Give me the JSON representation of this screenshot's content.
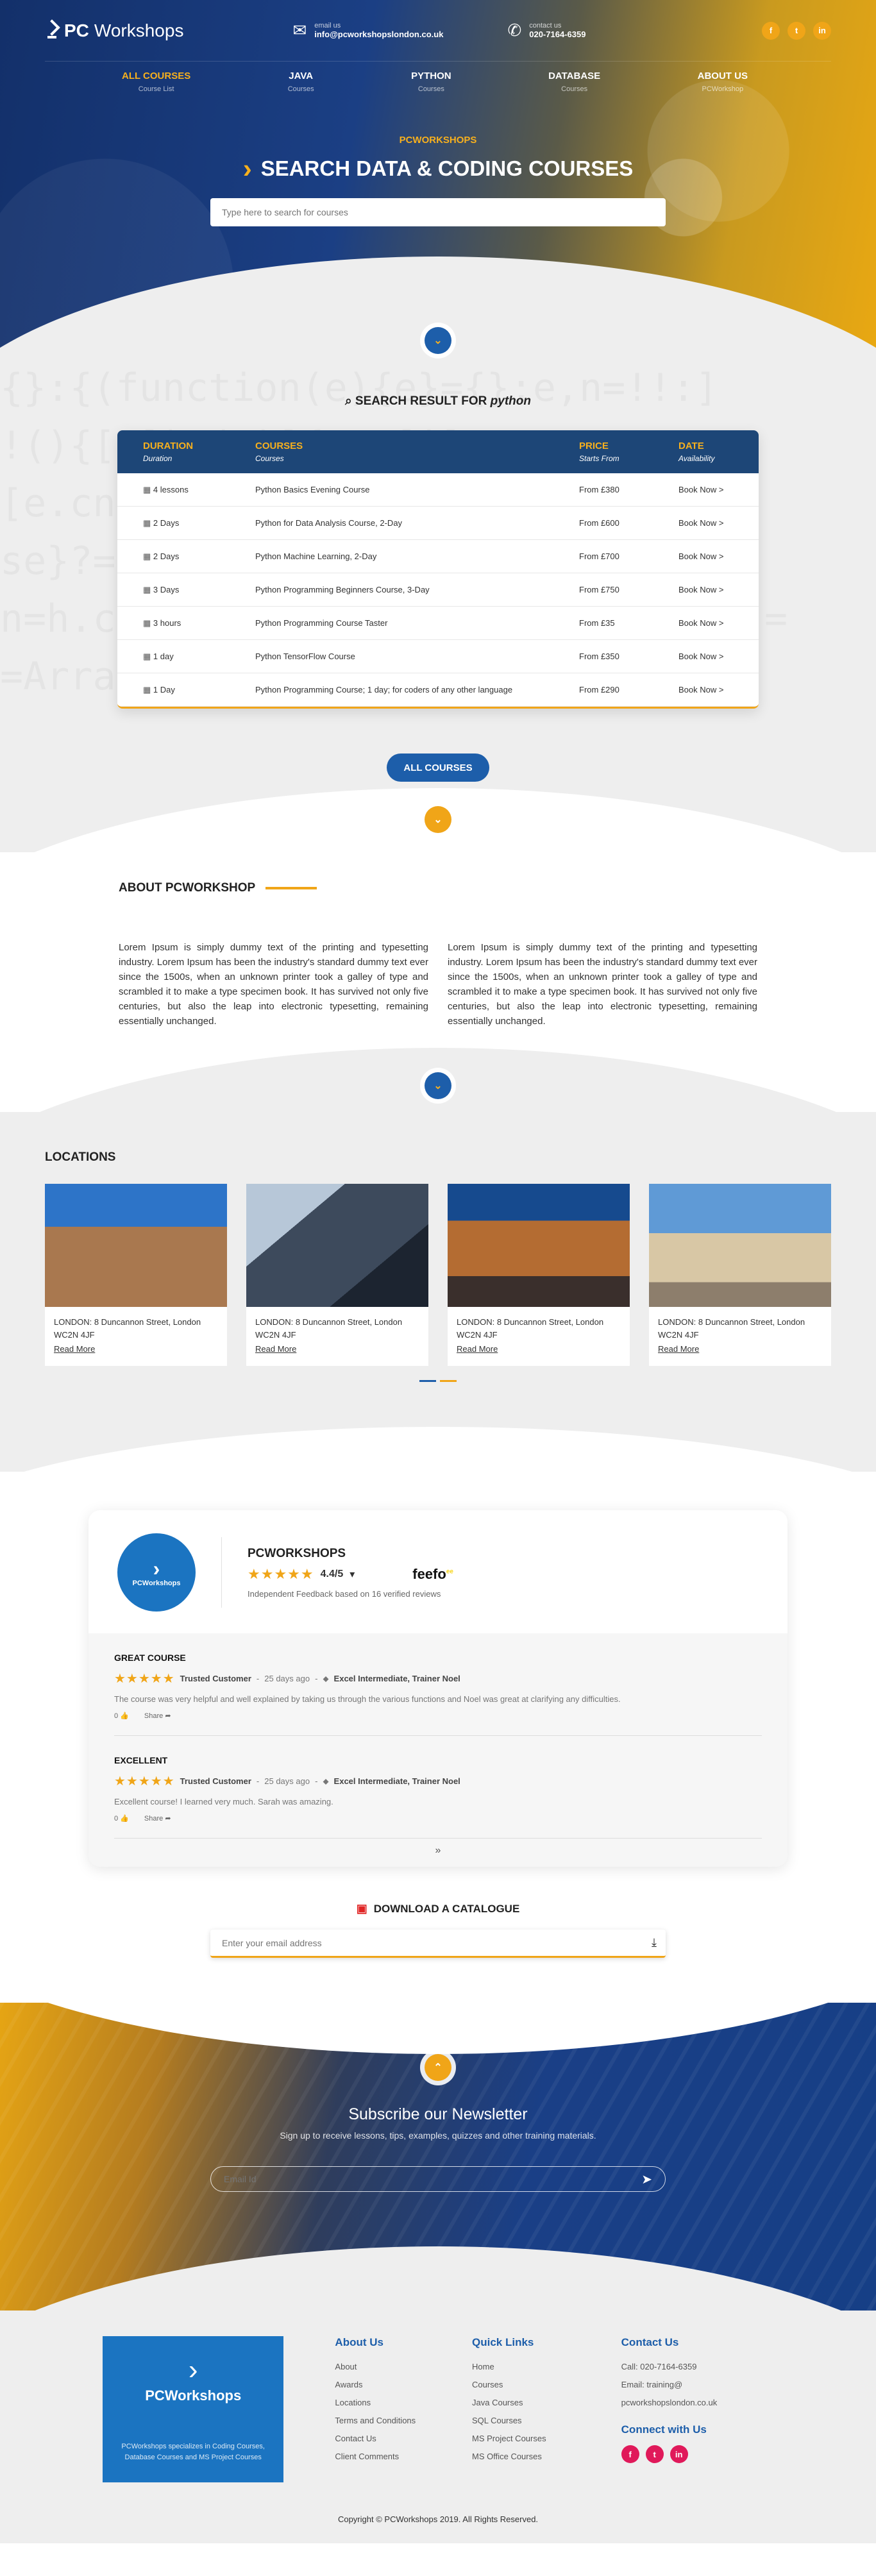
{
  "header": {
    "logo_bold": "PC",
    "logo_rest": "Workshops",
    "email_label": "email us",
    "email": "info@pcworkshopslondon.co.uk",
    "phone_label": "contact us",
    "phone": "020-7164-6359",
    "social": [
      "f",
      "t",
      "in"
    ]
  },
  "nav": [
    {
      "label": "ALL COURSES",
      "sub": "Course List"
    },
    {
      "label": "JAVA",
      "sub": "Courses"
    },
    {
      "label": "PYTHON",
      "sub": "Courses"
    },
    {
      "label": "DATABASE",
      "sub": "Courses"
    },
    {
      "label": "ABOUT US",
      "sub": "PCWorkshop"
    }
  ],
  "hero": {
    "eyebrow": "PCWORKSHOPS",
    "title": "SEARCH DATA & CODING COURSES",
    "search_placeholder": "Type here to search for courses"
  },
  "results": {
    "heading": "SEARCH RESULT FOR",
    "query": "python",
    "columns": [
      {
        "title": "DURATION",
        "sub": "Duration"
      },
      {
        "title": "COURSES",
        "sub": "Courses"
      },
      {
        "title": "PRICE",
        "sub": "Starts From"
      },
      {
        "title": "DATE",
        "sub": "Availability"
      }
    ],
    "rows": [
      {
        "duration": "4 lessons",
        "course": "Python Basics Evening Course",
        "price": "From £380",
        "date": "Book Now >"
      },
      {
        "duration": "2 Days",
        "course": "Python for Data Analysis Course, 2-Day",
        "price": "From £600",
        "date": "Book Now >"
      },
      {
        "duration": "2 Days",
        "course": "Python Machine Learning, 2-Day",
        "price": "From £700",
        "date": "Book Now >"
      },
      {
        "duration": "3 Days",
        "course": "Python Programming Beginners Course, 3-Day",
        "price": "From £750",
        "date": "Book Now >"
      },
      {
        "duration": "3 hours",
        "course": "Python Programming Course Taster",
        "price": "From £35",
        "date": "Book Now >"
      },
      {
        "duration": "1 day",
        "course": "Python TensorFlow Course",
        "price": "From £350",
        "date": "Book Now >"
      },
      {
        "duration": "1 Day",
        "course": "Python Programming Course; 1 day; for coders of any other language",
        "price": "From £290",
        "date": "Book Now >"
      }
    ],
    "all_courses_label": "ALL COURSES"
  },
  "about": {
    "title": "ABOUT PCWORKSHOP",
    "col1": "Lorem Ipsum is simply dummy text of the printing and typesetting industry. Lorem Ipsum has been the industry's standard dummy text ever since the 1500s, when an unknown printer took a galley of type and scrambled it to make a type specimen book. It has survived not only five centuries, but also the leap into electronic typesetting, remaining essentially unchanged.",
    "col2": "Lorem Ipsum is simply dummy text of the printing and typesetting industry. Lorem Ipsum has been the industry's standard dummy text ever since the 1500s, when an unknown printer took a galley of type and scrambled it to make a type specimen book. It has survived not only five centuries, but also the leap into electronic typesetting, remaining essentially unchanged."
  },
  "locations": {
    "title": "LOCATIONS",
    "cards": [
      {
        "address": "LONDON: 8 Duncannon Street, London WC2N 4JF",
        "link": "Read More"
      },
      {
        "address": "LONDON: 8 Duncannon Street, London WC2N 4JF",
        "link": "Read More"
      },
      {
        "address": "LONDON: 8 Duncannon Street, London WC2N 4JF",
        "link": "Read More"
      },
      {
        "address": "LONDON: 8 Duncannon Street, London WC2N 4JF",
        "link": "Read More"
      }
    ]
  },
  "reviews": {
    "logo_text": "PCWorkshops",
    "brand": "PCWORKSHOPS",
    "score": "4.4/5",
    "feefo": "feefo",
    "feefo_sup": "ee",
    "summary": "Independent Feedback based on 16 verified reviews",
    "items": [
      {
        "title": "GREAT COURSE",
        "stars": 5,
        "customer": "Trusted Customer",
        "time": "25 days ago",
        "tag": "Excel Intermediate, Trainer Noel",
        "text": "The course was very helpful and well explained by taking us through the various functions and Noel was great at clarifying any difficulties.",
        "likes": "0",
        "share": "Share"
      },
      {
        "title": "EXCELLENT",
        "stars": 5,
        "customer": "Trusted Customer",
        "time": "25 days ago",
        "tag": "Excel Intermediate, Trainer Noel",
        "text": "Excellent course! I learned very much. Sarah was amazing.",
        "likes": "0",
        "share": "Share"
      }
    ]
  },
  "catalogue": {
    "title": "DOWNLOAD A CATALOGUE",
    "placeholder": "Enter your email address"
  },
  "newsletter": {
    "title": "Subscribe our Newsletter",
    "subtitle": "Sign up to receive lessons, tips, examples, quizzes and other training materials.",
    "placeholder": "Email Id"
  },
  "footer": {
    "brand_bold": "PC",
    "brand_rest": "Workshops",
    "brand_text": "PCWorkshops specializes in Coding Courses, Database Courses and MS Project Courses",
    "about_title": "About Us",
    "about_links": [
      "About",
      "Awards",
      "Locations",
      "Terms and Conditions",
      "Contact Us",
      "Client Comments"
    ],
    "quick_title": "Quick Links",
    "quick_links": [
      "Home",
      "Courses",
      "Java Courses",
      "SQL Courses",
      "MS Project Courses",
      "MS Office Courses"
    ],
    "contact_title": "Contact Us",
    "call": "Call: 020-7164-6359",
    "email": "Email: training@ pcworkshopslondon.co.uk",
    "connect_title": "Connect with Us",
    "social": [
      "f",
      "t",
      "in"
    ],
    "copyright": "Copyright © PCWorkshops 2019. All Rights Reserved."
  },
  "colors": {
    "primary_blue": "#1d5eaa",
    "accent_orange": "#f0a518",
    "table_header": "#1d4677",
    "footer_social": "#e0195a"
  }
}
